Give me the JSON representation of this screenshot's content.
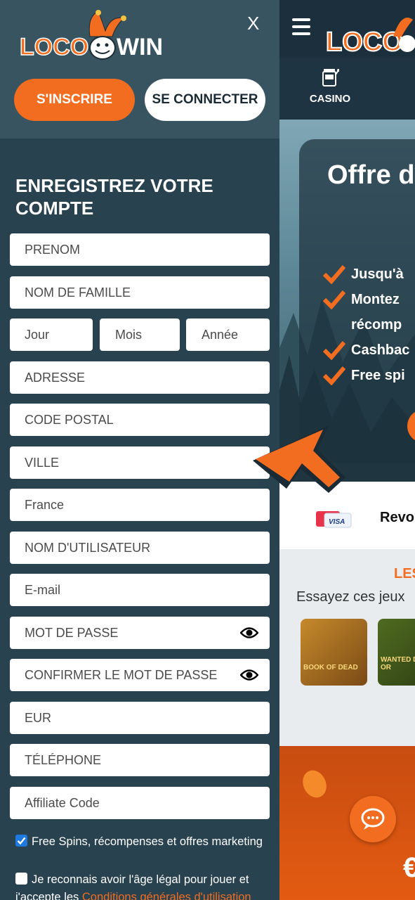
{
  "drawer": {
    "close_label": "X",
    "brand_left": "LOCO",
    "brand_right": "WIN",
    "signup_label": "S'INSCRIRE",
    "login_label": "SE CONNECTER",
    "form_title": "ENREGISTREZ VOTRE COMPTE",
    "fields": {
      "first_name": "PRENOM",
      "last_name": "NOM DE FAMILLE",
      "day": "Jour",
      "month": "Mois",
      "year": "Année",
      "address": "ADRESSE",
      "postal_code": "CODE POSTAL",
      "city": "VILLE",
      "country": "France",
      "username": "NOM D'UTILISATEUR",
      "email": "E-mail",
      "password": "MOT DE PASSE",
      "confirm_password": "CONFIRMER LE MOT DE PASSE",
      "currency": "EUR",
      "phone": "TÉLÉPHONE",
      "affiliate": "Affiliate Code"
    },
    "checkbox_marketing": "Free Spins, récompenses et offres marketing",
    "checkbox_terms": "Je reconnais avoir l'âge légal pour jouer et j'accepte les",
    "terms_link": "Conditions générales d'utilisation",
    "marketing_checked": true,
    "terms_checked": false
  },
  "site": {
    "nav_casino": "CASINO",
    "hero_title": "Offre d",
    "hero_items": [
      "Jusqu'à",
      "Montez",
      "récomp",
      "Cashbac",
      "Free spi"
    ],
    "payment_revol": "Revol",
    "games_heading": "LES",
    "games_sub": "Essayez ces jeux",
    "game1": "BOOK OF DEAD",
    "game2": "WANTED DEAD OR",
    "euro": "€"
  },
  "colors": {
    "accent": "#f26d1f",
    "drawer_bg": "#284250",
    "drawer_header": "#385461",
    "topbar": "#1b2f3c"
  }
}
